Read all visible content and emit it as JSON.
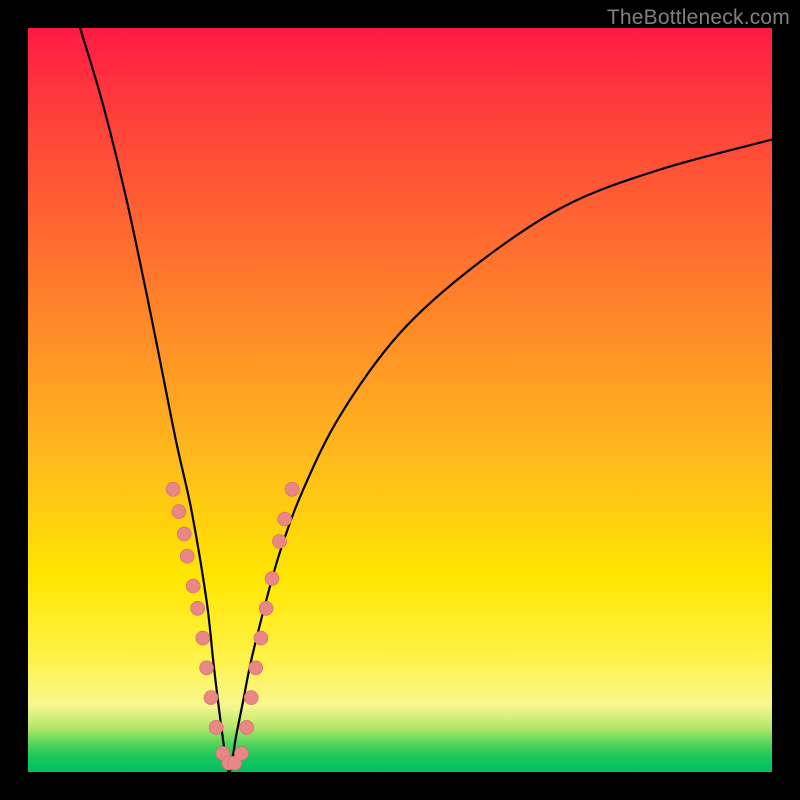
{
  "watermark": "TheBottleneck.com",
  "colors": {
    "curve": "#000000",
    "dot_fill": "#e98787",
    "dot_stroke": "#d06a6a",
    "background_black": "#000000"
  },
  "chart_data": {
    "type": "line",
    "title": "",
    "xlabel": "",
    "ylabel": "",
    "xlim": [
      0,
      100
    ],
    "ylim": [
      0,
      100
    ],
    "x_apex": 27,
    "series": [
      {
        "name": "bottleneck-curve",
        "comment": "x is a notional 0-100 horizontal axis; y is 0-100 where 0=bottom(green) 100=top(red). Values estimated from pixels.",
        "x": [
          7,
          10,
          13,
          16,
          18,
          20,
          22,
          24,
          25,
          26,
          27,
          28,
          29,
          30,
          32,
          34,
          37,
          42,
          50,
          60,
          72,
          85,
          100
        ],
        "y": [
          100,
          90,
          78,
          64,
          54,
          44,
          35,
          23,
          14,
          6,
          0,
          5,
          10,
          15,
          23,
          30,
          38,
          48,
          59,
          68,
          76,
          81,
          85
        ]
      }
    ],
    "dots": {
      "comment": "salmon dots clustered near the valley; same coordinate system as series",
      "points": [
        {
          "x": 19.5,
          "y": 38
        },
        {
          "x": 20.3,
          "y": 35
        },
        {
          "x": 21.0,
          "y": 32
        },
        {
          "x": 21.4,
          "y": 29
        },
        {
          "x": 22.2,
          "y": 25
        },
        {
          "x": 22.8,
          "y": 22
        },
        {
          "x": 23.5,
          "y": 18
        },
        {
          "x": 24.0,
          "y": 14
        },
        {
          "x": 24.6,
          "y": 10
        },
        {
          "x": 25.3,
          "y": 6
        },
        {
          "x": 26.2,
          "y": 2.5
        },
        {
          "x": 27.0,
          "y": 1.2
        },
        {
          "x": 27.8,
          "y": 1.2
        },
        {
          "x": 28.7,
          "y": 2.5
        },
        {
          "x": 29.4,
          "y": 6
        },
        {
          "x": 30.0,
          "y": 10
        },
        {
          "x": 30.6,
          "y": 14
        },
        {
          "x": 31.3,
          "y": 18
        },
        {
          "x": 32.0,
          "y": 22
        },
        {
          "x": 32.8,
          "y": 26
        },
        {
          "x": 33.8,
          "y": 31
        },
        {
          "x": 34.5,
          "y": 34
        },
        {
          "x": 35.5,
          "y": 38
        }
      ],
      "radius_px": 7
    }
  }
}
